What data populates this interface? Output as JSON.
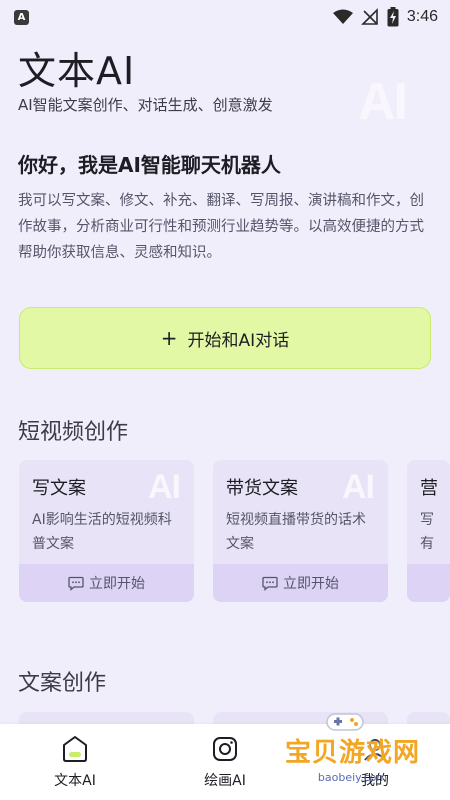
{
  "status": {
    "time": "3:46",
    "app_badge": "A"
  },
  "header": {
    "title": "文本AI",
    "subtitle": "AI智能文案创作、对话生成、创意激发",
    "watermark": "AI"
  },
  "intro": {
    "greeting": "你好，我是AI智能聊天机器人",
    "description": "我可以写文案、修文、补充、翻译、写周报、演讲稿和作文，创作故事，分析商业可行性和预测行业趋势等。以高效便捷的方式帮助你获取信息、灵感和知识。"
  },
  "start_button": {
    "icon": "plus-icon",
    "label": "开始和AI对话"
  },
  "sections": [
    {
      "title": "短视频创作",
      "cards": [
        {
          "title": "写文案",
          "description": "AI影响生活的短视频科普文案",
          "action": "立即开始"
        },
        {
          "title": "带货文案",
          "description": "短视频直播带货的话术文案",
          "action": "立即开始"
        },
        {
          "title": "营",
          "description": "写有"
        }
      ]
    },
    {
      "title": "文案创作"
    }
  ],
  "nav": [
    {
      "label": "文本AI",
      "icon": "chat-bubble-icon",
      "active": true
    },
    {
      "label": "绘画AI",
      "icon": "camera-icon"
    },
    {
      "label": "我的",
      "icon": "profile-icon"
    }
  ],
  "site_watermark": {
    "text": "宝贝游戏网",
    "url": "baobeiy.com"
  },
  "colors": {
    "background": "#f1eefb",
    "accent": "#e3f8a4",
    "card": "#e8e3f6",
    "card_action": "#dcd3f5"
  }
}
